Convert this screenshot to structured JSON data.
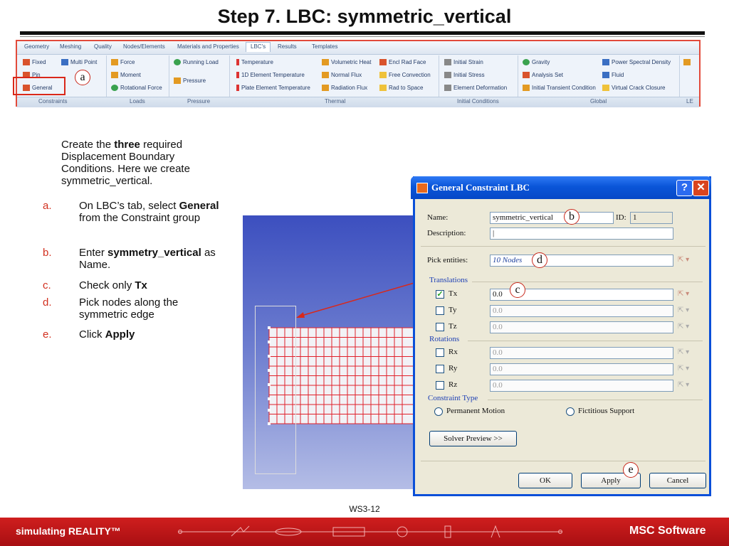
{
  "title": "Step 7. LBC: symmetric_vertical",
  "ribbon": {
    "tabs": [
      "Geometry",
      "Meshing",
      "Quality",
      "Nodes/Elements",
      "Materials and Properties",
      "LBC's",
      "Results",
      "Templates"
    ],
    "active_tab": "LBC's",
    "constraints": [
      "Fixed",
      "Multi Point",
      "Pin",
      "General"
    ],
    "loads": [
      "Force",
      "Moment",
      "Rotational Force"
    ],
    "pressure": [
      "Running Load",
      "Pressure"
    ],
    "thermal": [
      "Temperature",
      "1D Element Temperature",
      "Plate Element Temperature",
      "Volumetric Heat",
      "Normal Flux",
      "Radiation Flux",
      "Encl Rad Face",
      "Free Convection",
      "Rad to Space"
    ],
    "initial_conditions": [
      "Initial Strain",
      "Initial Stress",
      "Element Deformation"
    ],
    "global": [
      "Gravity",
      "Analysis Set",
      "Initial Transient Condition",
      "Power Spectral Density",
      "Fluid",
      "Virtual Crack Closure"
    ],
    "groups": [
      "Constraints",
      "Loads",
      "Pressure",
      "Thermal",
      "Initial Conditions",
      "Global",
      "LE"
    ]
  },
  "callouts": {
    "a": "a",
    "b": "b",
    "c": "c",
    "d": "d",
    "e": "e"
  },
  "instructions": {
    "intro_pre": "Create the ",
    "intro_bold": "three",
    "intro_post": " required Displacement Boundary Conditions. Here we create symmetric_vertical.",
    "steps": [
      {
        "letter": "a.",
        "pre": "On LBC’s tab, select ",
        "bold": "General",
        "post": " from the Constraint group"
      },
      {
        "letter": "b.",
        "pre": "Enter ",
        "bold": "symmetry_vertical",
        "post": " as Name."
      },
      {
        "letter": "c.",
        "pre": "Check only ",
        "bold": "Tx",
        "post": ""
      },
      {
        "letter": "d.",
        "pre": "Pick nodes along the symmetric edge",
        "bold": "",
        "post": ""
      },
      {
        "letter": "e.",
        "pre": "Click ",
        "bold": "Apply",
        "post": ""
      }
    ]
  },
  "dialog": {
    "title": "General Constraint LBC",
    "help": "?",
    "close": "✕",
    "name_label": "Name:",
    "name_value": "symmetric_vertical",
    "id_label": "ID:",
    "id_value": "1",
    "description_label": "Description:",
    "description_value": "|",
    "pick_label": "Pick entities:",
    "pick_value": "10 Nodes",
    "translations_label": "Translations",
    "translations": [
      {
        "label": "Tx",
        "checked": true,
        "value": "0.0"
      },
      {
        "label": "Ty",
        "checked": false,
        "value": "0.0"
      },
      {
        "label": "Tz",
        "checked": false,
        "value": "0.0"
      }
    ],
    "rotations_label": "Rotations",
    "rotations": [
      {
        "label": "Rx",
        "checked": false,
        "value": "0.0"
      },
      {
        "label": "Ry",
        "checked": false,
        "value": "0.0"
      },
      {
        "label": "Rz",
        "checked": false,
        "value": "0.0"
      }
    ],
    "constraint_type_label": "Constraint Type",
    "permanent_motion": "Permanent Motion",
    "fictitious_support": "Fictitious Support",
    "solver_preview": "Solver Preview >>",
    "ok": "OK",
    "apply": "Apply",
    "cancel": "Cancel"
  },
  "slide_number": "WS3-12",
  "footer": {
    "left": "simulating REALITY™",
    "right": "MSC Software"
  },
  "colors": {
    "accent_red": "#d2301f",
    "dialog_blue": "#0a55d8",
    "ribbon_bg": "#eef3fa"
  }
}
